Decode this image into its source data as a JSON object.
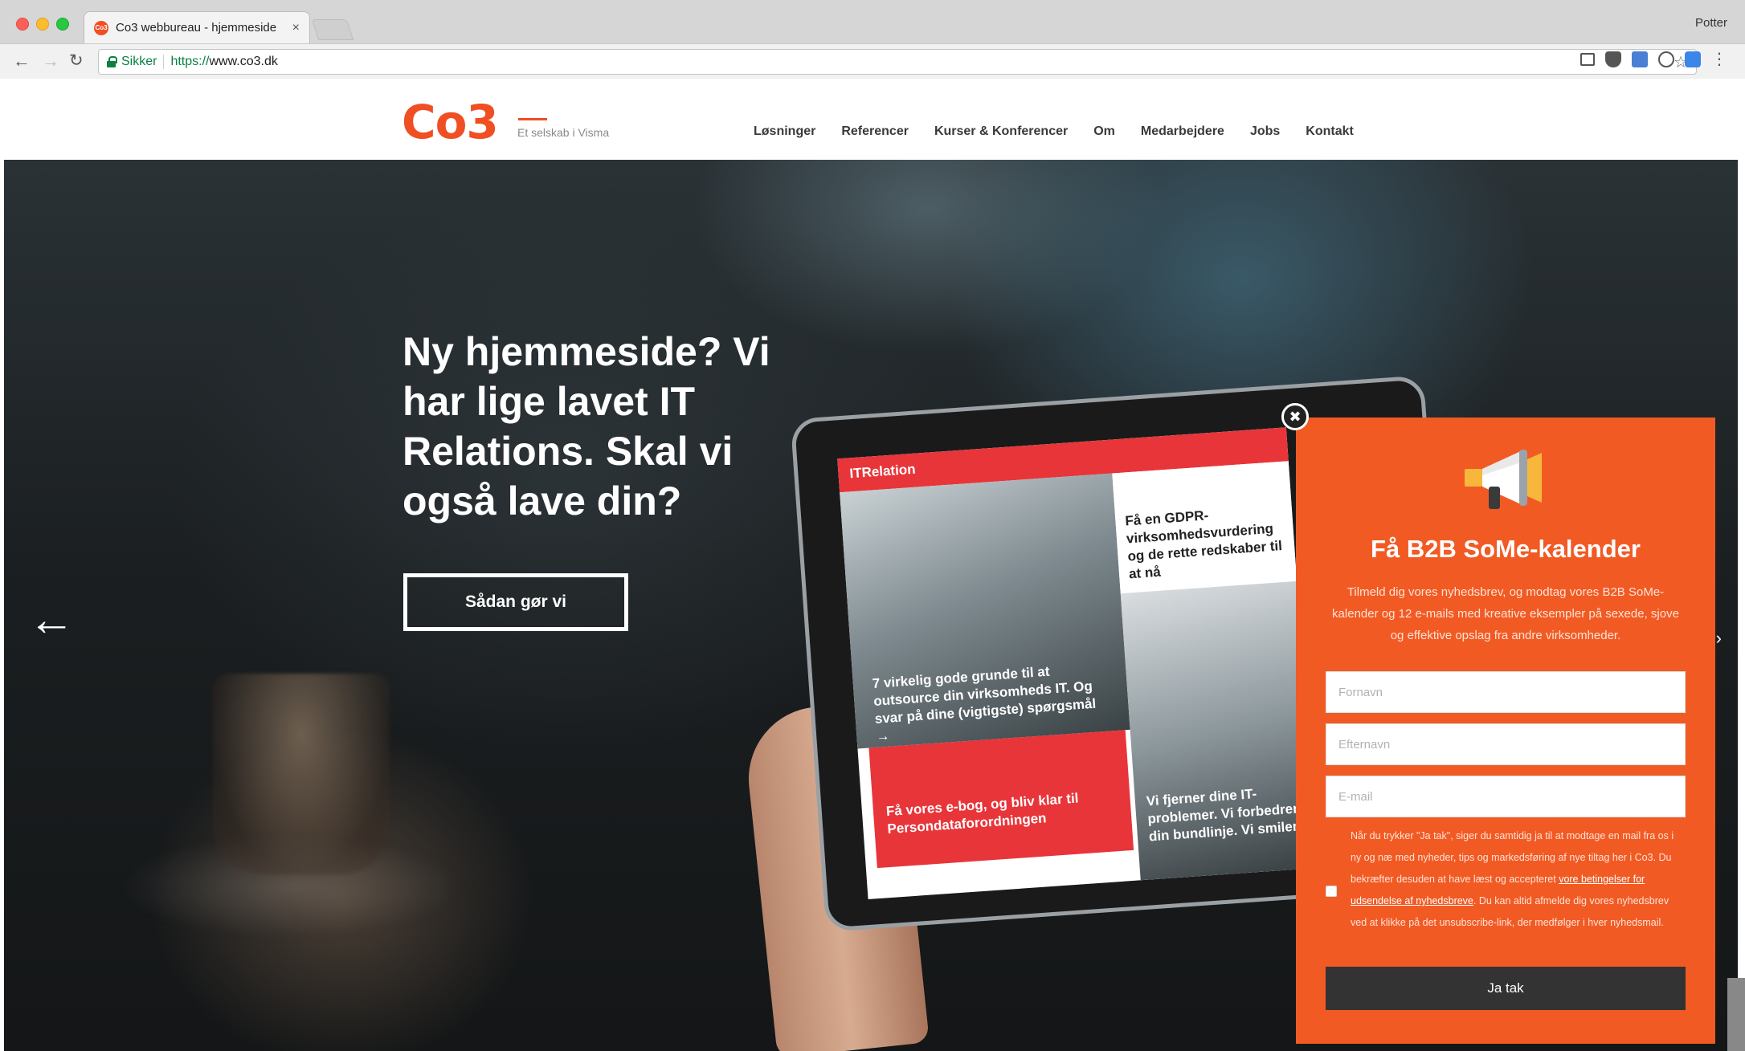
{
  "browser": {
    "tab_title": "Co3 webbureau - hjemmeside",
    "tab_favicon": "Co3",
    "tab_close": "×",
    "profile": "Potter",
    "secure_label": "Sikker",
    "url_protocol": "https://",
    "url_host": "www.co3.dk",
    "star": "☆",
    "nav_icons": [
      "back-arrow-icon",
      "forward-arrow-icon",
      "reload-icon"
    ],
    "extension_icons": [
      "screenshot-icon",
      "pocket-icon",
      "translate-icon",
      "ghostery-icon",
      "cast-icon",
      "menu-dots-icon"
    ]
  },
  "site": {
    "logo": "Co3",
    "tagline": "Et selskab i Visma",
    "brand_color": "#f04e23",
    "nav": [
      "Løsninger",
      "Referencer",
      "Kurser & Konferencer",
      "Om",
      "Medarbejdere",
      "Jobs",
      "Kontakt"
    ]
  },
  "hero": {
    "headline": "Ny hjemmeside? Vi har lige lavet IT Relations. Skal vi også lave din?",
    "cta": "Sådan gør vi",
    "prev_arrow": "←",
    "next_arrow": "›",
    "tablet": {
      "logo": "ITRelation",
      "card1": "Få en GDPR-virksomhedsvurdering og de rette redskaber til at nå",
      "photo1_caption": "7 virkelig gode grunde til at outsource din virksomheds IT. Og svar på dine (vigtigste) spørgsmål →",
      "photo2_caption": "Vi fjerner dine IT-problemer. Vi forbedrer din bundlinje. Vi smiler,",
      "red_card": "Få vores e-bog, og bliv klar til Persondataforordningen"
    }
  },
  "popup": {
    "close": "✖",
    "icon": "megaphone-icon",
    "title": "Få B2B SoMe-kalender",
    "description": "Tilmeld dig vores nyhedsbrev, og modtag vores B2B SoMe-kalender og 12 e-mails med kreative eksempler på sexede, sjove og effektive opslag fra andre virksomheder.",
    "first_name_placeholder": "Fornavn",
    "last_name_placeholder": "Efternavn",
    "email_placeholder": "E-mail",
    "consent_before": "Når du trykker \"Ja tak\", siger du samtidig ja til at modtage en mail fra os i ny og næ med nyheder, tips og markedsføring af nye tiltag her i Co3. Du bekræfter desuden at have læst og accepteret ",
    "consent_link": "vore betingelser for udsendelse af nyhedsbreve",
    "consent_after": ". Du kan altid afmelde dig vores nyhedsbrev ved at klikke på det unsubscribe-link, der medfølger i hver nyhedsmail.",
    "submit": "Ja tak",
    "accent_color": "#f25a24"
  }
}
